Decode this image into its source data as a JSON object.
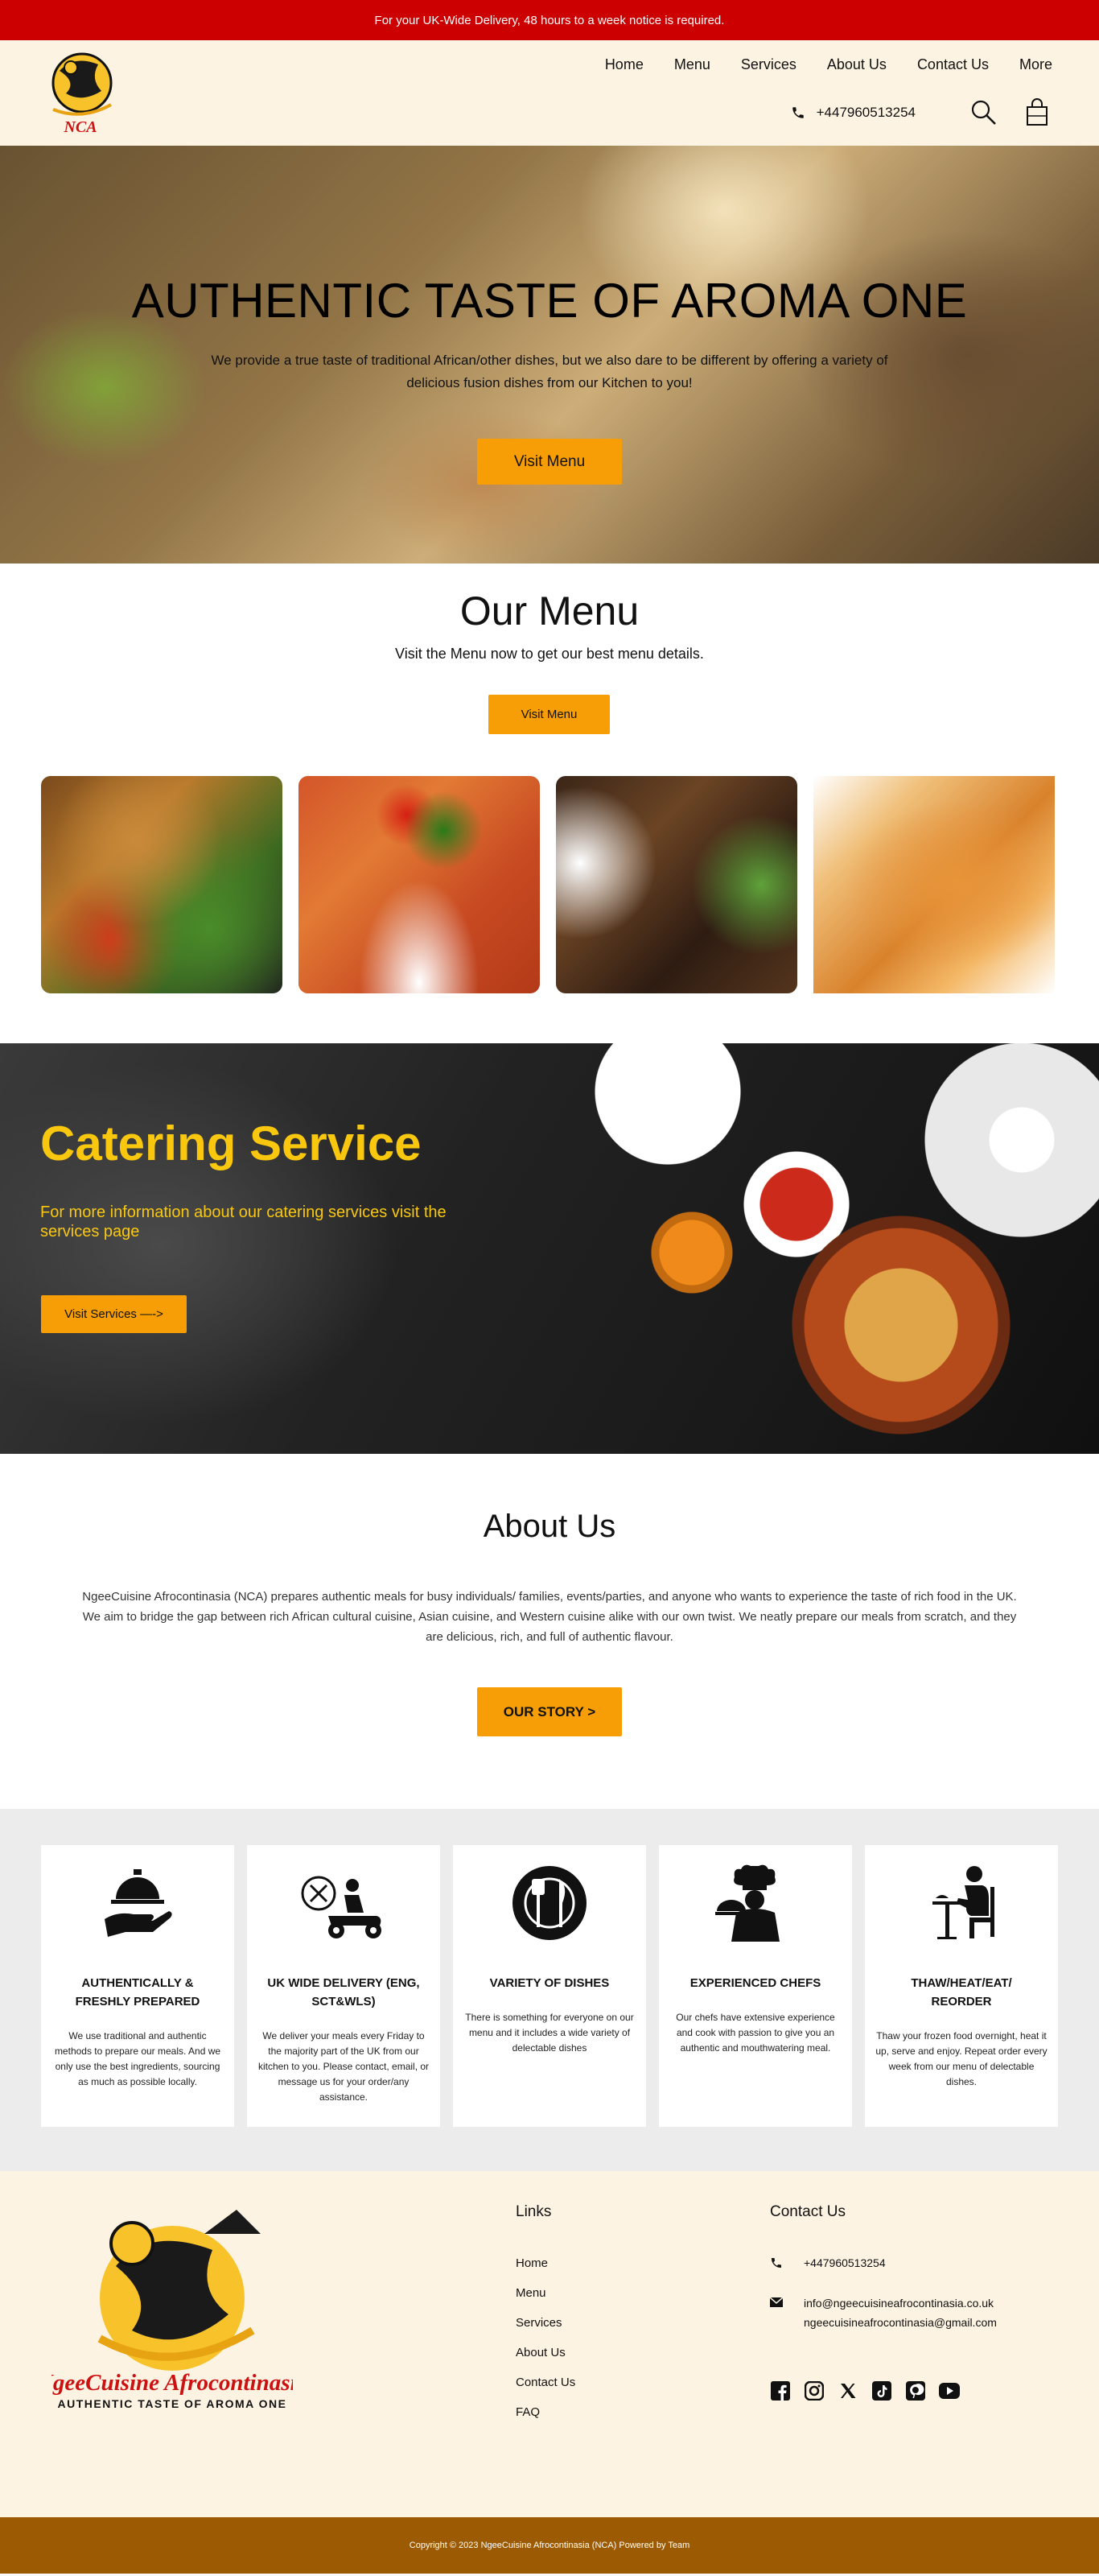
{
  "topbar": {
    "text": "For your UK-Wide Delivery, 48 hours to a week notice is required."
  },
  "header": {
    "logo_text": "NCA",
    "nav": [
      "Home",
      "Menu",
      "Services",
      "About Us",
      "Contact Us",
      "More"
    ],
    "phone": "+447960513254",
    "icons": [
      "phone-icon",
      "search-icon",
      "shopping-bag-icon"
    ]
  },
  "hero": {
    "title": "AUTHENTIC TASTE OF AROMA ONE",
    "text": "We provide a true taste of traditional African/other dishes, but we also dare to be different by offering a variety of delicious fusion dishes from our Kitchen to you!",
    "button": "Visit Menu"
  },
  "menu": {
    "title": "Our Menu",
    "subtitle": "Visit the Menu now to get our best menu details.",
    "button": "Visit Menu"
  },
  "catering": {
    "title": "Catering Service",
    "text": "For more information about our catering services visit the services page",
    "button": "Visit Services —->"
  },
  "about": {
    "title": "About Us",
    "text": "NgeeCuisine Afrocontinasia (NCA) prepares authentic meals for busy individuals/ families, events/parties, and anyone who wants to experience the taste of rich food in the UK. We aim to bridge the gap between rich African cultural cuisine, Asian cuisine, and Western cuisine alike with our own twist. We neatly prepare our meals from scratch, and they are delicious, rich, and full of authentic flavour.",
    "button": "OUR STORY  >"
  },
  "features": [
    {
      "icon": "serving-tray-icon",
      "title": "AUTHENTICALLY & FRESHLY PREPARED",
      "text": "We use traditional and authentic methods to prepare our meals. And we only use the best ingredients, sourcing as much as possible locally."
    },
    {
      "icon": "delivery-scooter-icon",
      "title": "UK WIDE DELIVERY (ENG, SCT&WLS)",
      "text": "We deliver your meals every Friday to the majority part of the UK from our kitchen to you. Please contact, email, or message us for your order/any assistance."
    },
    {
      "icon": "plate-cutlery-icon",
      "title": "VARIETY OF DISHES",
      "text": "There is something for everyone on our menu and it includes a wide variety of delectable dishes"
    },
    {
      "icon": "chef-icon",
      "title": "EXPERIENCED CHEFS",
      "text": "Our chefs have extensive experience and cook with passion to give you an authentic and mouthwatering meal."
    },
    {
      "icon": "dining-person-icon",
      "title": "THAW/HEAT/EAT/ REORDER",
      "text": "Thaw your frozen food overnight, heat it up, serve and enjoy. Repeat order every week from our menu of delectable dishes."
    }
  ],
  "footer": {
    "brand": "NgeeCuisine Afrocontinasia",
    "tagline": "AUTHENTIC TASTE OF AROMA ONE",
    "links_title": "Links",
    "links": [
      "Home",
      "Menu",
      "Services",
      "About Us",
      "Contact Us",
      "FAQ"
    ],
    "contact_title": "Contact Us",
    "phone": "+447960513254",
    "emails": [
      "info@ngeecuisineafrocontinasia.co.uk",
      "ngeecuisineafrocontinasia@gmail.com"
    ],
    "socials": [
      "facebook-icon",
      "instagram-icon",
      "x-icon",
      "tiktok-icon",
      "pinterest-icon",
      "youtube-icon"
    ]
  },
  "copyright": "Copyright © 2023 NgeeCuisine Afrocontinasia (NCA) Powered by Team",
  "colors": {
    "topbar": "#cc0000",
    "accent": "#f79e06",
    "catering_title": "#f9c80e",
    "cream": "#fdf3e3",
    "copyright_bar": "#9c5b02"
  }
}
